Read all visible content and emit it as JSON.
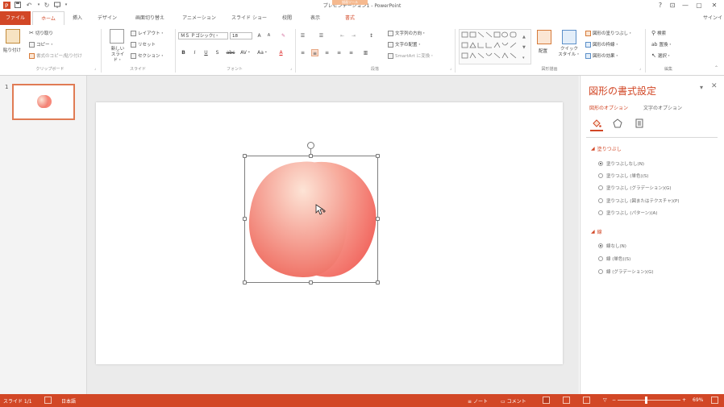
{
  "window": {
    "title": "プレゼンテーション1 - PowerPoint",
    "contextual_tab_group": "描画ツール",
    "help": "?",
    "ribbon_display": "⊡",
    "minimize": "—",
    "restore": "▢",
    "close": "✕",
    "signin": "サインイ"
  },
  "tabs": [
    {
      "label": "ファイル"
    },
    {
      "label": "ホーム"
    },
    {
      "label": "挿入"
    },
    {
      "label": "デザイン"
    },
    {
      "label": "画面切り替え"
    },
    {
      "label": "アニメーション"
    },
    {
      "label": "スライド ショー"
    },
    {
      "label": "校閲"
    },
    {
      "label": "表示"
    },
    {
      "label": "書式"
    }
  ],
  "ribbon": {
    "clipboard": {
      "label": "クリップボード",
      "paste": "貼り付け",
      "cut": "切り取り",
      "copy": "コピー・",
      "format_painter": "書式のコピー/貼り付け"
    },
    "slides": {
      "label": "スライド",
      "new_slide_1": "新しい",
      "new_slide_2": "スライド・",
      "layout": "レイアウト・",
      "reset": "リセット",
      "section": "セクション・"
    },
    "font": {
      "label": "フォント",
      "font_name": "ＭＳ Ｐゴシック(・",
      "font_size": "18",
      "grow": "A",
      "shrink": "A",
      "clear": "✎",
      "bold": "B",
      "italic": "I",
      "underline": "U",
      "shadow": "S",
      "strike": "abc",
      "spacing": "AV・",
      "case": "Aa・",
      "color": "A"
    },
    "paragraph": {
      "label": "段落",
      "text_direction": "文字列の方向・",
      "align_text": "文字の配置・",
      "smartart": "SmartArt に変換・"
    },
    "drawing": {
      "label": "図形描画",
      "arrange": "配置",
      "quick_styles_1": "クイック",
      "quick_styles_2": "スタイル・",
      "fill": "図形の塗りつぶし・",
      "outline": "図形の枠線・",
      "effects": "図形の効果・"
    },
    "editing": {
      "label": "編集",
      "find": "検索",
      "replace": "置換・",
      "select": "選択・"
    }
  },
  "thumbnails": [
    {
      "number": "1"
    }
  ],
  "format_pane": {
    "title": "図形の書式設定",
    "tab_shape": "図形のオプション",
    "tab_text": "文字のオプション",
    "fill_section": "塗りつぶし",
    "fill_options": [
      {
        "label": "塗りつぶしなし(N)",
        "checked": true
      },
      {
        "label": "塗りつぶし (単色)(S)",
        "checked": false
      },
      {
        "label": "塗りつぶし (グラデーション)(G)",
        "checked": false
      },
      {
        "label": "塗りつぶし (図またはテクスチャ)(P)",
        "checked": false
      },
      {
        "label": "塗りつぶし (パターン)(A)",
        "checked": false
      }
    ],
    "line_section": "線",
    "line_options": [
      {
        "label": "線なし(N)",
        "checked": true
      },
      {
        "label": "線 (単色)(S)",
        "checked": false
      },
      {
        "label": "線 (グラデーション)(G)",
        "checked": false
      }
    ]
  },
  "statusbar": {
    "slide_info": "スライド 1/1",
    "language": "日本語",
    "notes": "ノート",
    "comments": "コメント",
    "zoom_minus": "−",
    "zoom_plus": "+",
    "zoom": "69%",
    "zoom_level": 0.45
  },
  "colors": {
    "accent": "#d24726",
    "shape_light": "#fde4d6",
    "shape_dark": "#f07468"
  }
}
